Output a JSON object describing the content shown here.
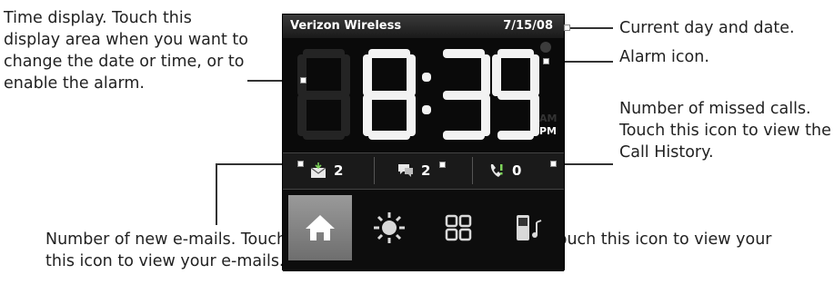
{
  "annotations": {
    "time_display": "Time display. Touch this display area when you want to change the date or time, or to enable the alarm.",
    "date": "Current day and date.",
    "alarm": "Alarm icon.",
    "missed_calls": "Number of missed calls. Touch this icon to view the Call History.",
    "emails": "Number of new e-mails. Touch this icon to view your e-mails.",
    "text_messages": "Number of new text messages. Touch this icon to view your text messages."
  },
  "widget": {
    "carrier": "Verizon Wireless",
    "date": "7/15/08",
    "time": "8:39",
    "meridiem_am": "AM",
    "meridiem_pm": "PM",
    "email_count": "2",
    "sms_count": "2",
    "missed_calls_count": "0"
  },
  "colors": {
    "digit": "#f2f2f2",
    "dim_digit": "#242424",
    "home_tab": "#8a8a8a"
  }
}
